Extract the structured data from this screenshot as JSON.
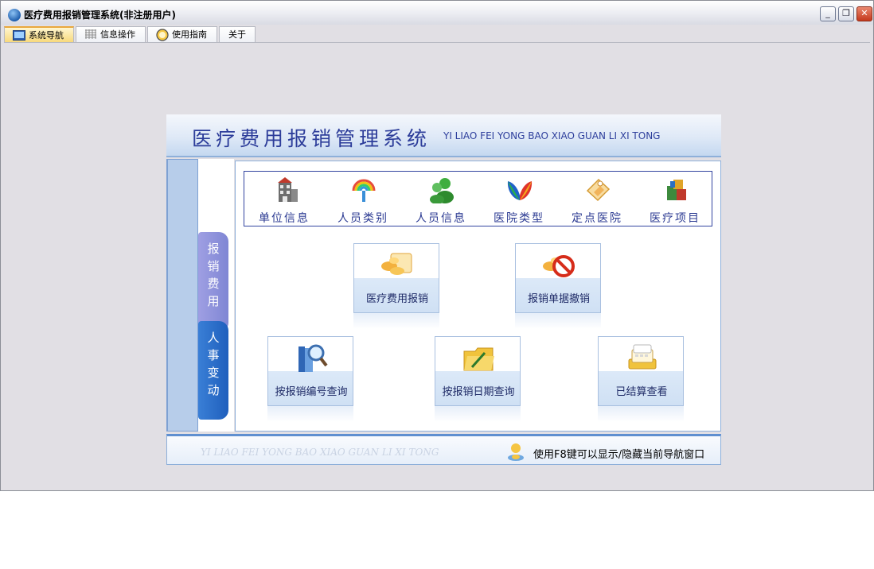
{
  "window": {
    "title": "医疗费用报销管理系统(非注册用户)",
    "minimize": "_",
    "restore": "❐",
    "close": "✕"
  },
  "tabs": [
    {
      "label": "系统导航",
      "icon": "monitor-icon",
      "active": true
    },
    {
      "label": "信息操作",
      "icon": "grid-icon",
      "active": false
    },
    {
      "label": "使用指南",
      "icon": "help-circle-icon",
      "active": false
    },
    {
      "label": "关于",
      "icon": "",
      "active": false
    }
  ],
  "header": {
    "title_cn": "医疗费用报销管理系统",
    "title_en": "YI LIAO FEI YONG BAO XIAO GUAN LI XI TONG"
  },
  "sidebar": {
    "tabs": [
      {
        "label": "报销费用",
        "color": "#8a8fdb"
      },
      {
        "label": "人事变动",
        "color": "#2766c6"
      }
    ]
  },
  "iconbar": [
    {
      "label": "单位信息",
      "icon": "building-icon"
    },
    {
      "label": "人员类别",
      "icon": "rainbow-umbrella-icon"
    },
    {
      "label": "人员信息",
      "icon": "users-icon"
    },
    {
      "label": "医院类型",
      "icon": "butterfly-icon"
    },
    {
      "label": "定点医院",
      "icon": "pin-card-icon"
    },
    {
      "label": "医疗项目",
      "icon": "boxes-icon"
    }
  ],
  "cards": [
    {
      "label": "医疗费用报销",
      "icon": "pills-card-icon"
    },
    {
      "label": "报销单据撤销",
      "icon": "cancel-pills-icon"
    },
    {
      "label": "按报销编号查询",
      "icon": "book-magnifier-icon"
    },
    {
      "label": "按报销日期查询",
      "icon": "folder-pen-icon"
    },
    {
      "label": "已结算查看",
      "icon": "calendar-stack-icon"
    }
  ],
  "footer": {
    "watermark": "YI LIAO FEI YONG BAO XIAO GUAN LI XI TONG",
    "hint": "使用F8键可以显示/隐藏当前导航窗口",
    "icon": "user-hint-icon"
  },
  "colors": {
    "title_blue": "#2d3d9a",
    "accent_blue": "#5f8fd0",
    "window_bg": "#e1dfe4"
  }
}
